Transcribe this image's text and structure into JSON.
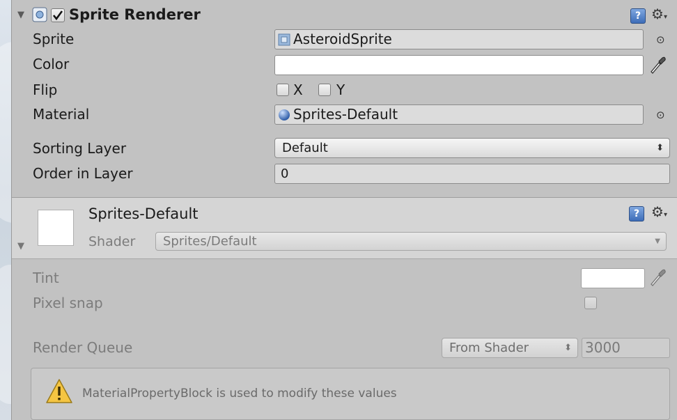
{
  "sprite_renderer": {
    "title": "Sprite Renderer",
    "enabled": true,
    "fields": {
      "sprite": {
        "label": "Sprite",
        "value": "AsteroidSprite"
      },
      "color": {
        "label": "Color",
        "value": "#FFFFFF"
      },
      "flip": {
        "label": "Flip",
        "x_label": "X",
        "y_label": "Y",
        "x_checked": false,
        "y_checked": false
      },
      "material": {
        "label": "Material",
        "value": "Sprites-Default"
      },
      "sorting_layer": {
        "label": "Sorting Layer",
        "value": "Default"
      },
      "order_in_layer": {
        "label": "Order in Layer",
        "value": "0"
      }
    },
    "icons": {
      "help": "help-book-icon",
      "settings": "gear-icon"
    }
  },
  "material": {
    "name": "Sprites-Default",
    "shader_label": "Shader",
    "shader_value": "Sprites/Default",
    "properties": {
      "tint": {
        "label": "Tint",
        "value": "#FFFFFF"
      },
      "pixel_snap": {
        "label": "Pixel snap",
        "checked": false
      },
      "render_queue": {
        "label": "Render Queue",
        "mode": "From Shader",
        "value": "3000"
      }
    }
  },
  "help_message": {
    "text": "MaterialPropertyBlock is used to modify these values",
    "icon": "warning-icon"
  },
  "colors": {
    "panel_bg": "#C2C2C2",
    "header_bg": "#D5D5D5",
    "accent": "#3D6DB8",
    "warning": "#F5C542"
  }
}
